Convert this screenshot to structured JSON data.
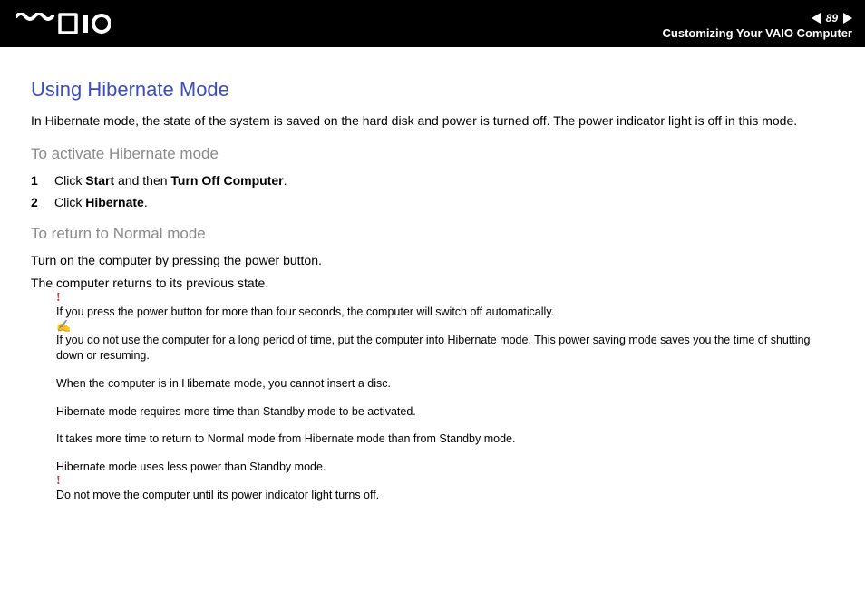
{
  "header": {
    "page_number": "89",
    "section": "Customizing Your VAIO Computer"
  },
  "title": "Using Hibernate Mode",
  "intro": "In Hibernate mode, the state of the system is saved on the hard disk and power is turned off. The power indicator light is off in this mode.",
  "sect_activate": {
    "heading": "To activate Hibernate mode",
    "steps": [
      {
        "num": "1",
        "pre": "Click ",
        "b1": "Start",
        "mid": " and then ",
        "b2": "Turn Off Computer",
        "post": "."
      },
      {
        "num": "2",
        "pre": "Click ",
        "b1": "Hibernate",
        "mid": "",
        "b2": "",
        "post": "."
      }
    ]
  },
  "sect_return": {
    "heading": "To return to Normal mode",
    "p1": "Turn on the computer by pressing the power button.",
    "p2": "The computer returns to its previous state."
  },
  "notes": {
    "warn1": "If you press the power button for more than four seconds, the computer will switch off automatically.",
    "tip1": "If you do not use the computer for a long period of time, put the computer into Hibernate mode. This power saving mode saves you the time of shutting down or resuming.",
    "tip2": "When the computer is in Hibernate mode, you cannot insert a disc.",
    "tip3": "Hibernate mode requires more time than Standby mode to be activated.",
    "tip4": "It takes more time to return to Normal mode from Hibernate mode than from Standby mode.",
    "tip5": "Hibernate mode uses less power than Standby mode.",
    "warn2": "Do not move the computer until its power indicator light turns off."
  }
}
